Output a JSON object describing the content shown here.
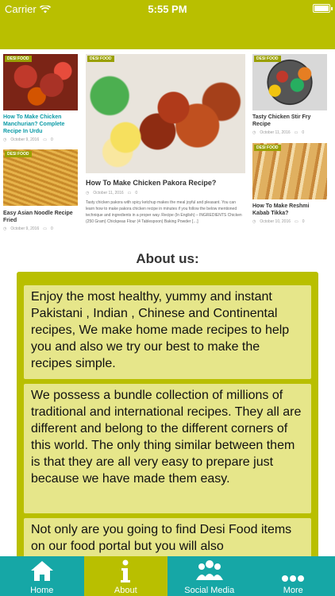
{
  "status": {
    "carrier": "Carrier",
    "time": "5:55 PM"
  },
  "posts": {
    "left_top": {
      "badge": "DESI FOOD",
      "title": "How To Make Chicken Manchurian? Complete Recipe In Urdu",
      "date": "October 9, 2016",
      "comments": "0"
    },
    "left_bottom": {
      "badge": "DESI FOOD",
      "title": "Easy Asian Noodle Recipe Fried",
      "date": "October 9, 2016",
      "comments": "0"
    },
    "featured": {
      "badge": "DESI FOOD",
      "title": "How To Make Chicken Pakora Recipe?",
      "date": "October 11, 2016",
      "comments": "0",
      "excerpt": "Tasty chicken pakora with spicy ketchup makes the meal joyful and pleasant. You can learn how to make pakora chicken recipe in minutes if you follow the below mentioned technique and ingredients in a proper way. Recipe (In English) – INGREDIENTS Chicken (250 Gram) Chickpeas Flour (4 Tablespoon) Baking Powder […]"
    },
    "right_top": {
      "badge": "DESI FOOD",
      "title": "Tasty Chicken Stir Fry Recipe",
      "date": "October 11, 2016",
      "comments": "0"
    },
    "right_bottom": {
      "badge": "DESI FOOD",
      "title": "How To Make Reshmi Kabab Tikka?",
      "date": "October 10, 2016",
      "comments": "0"
    }
  },
  "about": {
    "heading": "About us:",
    "paragraphs": [
      "Enjoy the most healthy, yummy and instant Pakistani , Indian , Chinese and Continental recipes, We make home made recipes to help you and also we try our best to make the recipes simple.",
      "We possess a bundle collection of millions of traditional and international recipes. They all are different and belong to the different corners of this world. The only thing similar between them is that they are all very easy to prepare just because we have made them easy.",
      "Not only are you going to find Desi Food items on our food portal but you will also"
    ]
  },
  "tabs": [
    {
      "label": "Home",
      "icon": "home-icon"
    },
    {
      "label": "About",
      "icon": "info-icon",
      "active": true
    },
    {
      "label": "Social Media",
      "icon": "people-icon"
    },
    {
      "label": "More",
      "icon": "more-icon"
    }
  ],
  "colors": {
    "accent": "#b9bf00",
    "tabbar": "#16a7a6",
    "paragraph_bg": "#e6e68a",
    "link": "#0a9aa6"
  }
}
